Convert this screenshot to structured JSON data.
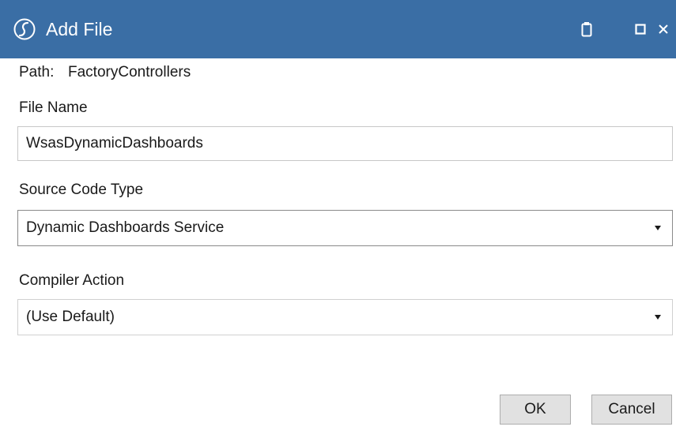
{
  "dialog": {
    "title": "Add File",
    "title_icon": "script-s-icon",
    "titlebar_buttons": [
      "clipboard-icon",
      "maximize-icon",
      "close-icon"
    ],
    "colors": {
      "titlebar": "#3a6ea5",
      "title_text": "#ffffff"
    }
  },
  "path": {
    "label": "Path:",
    "value": "FactoryControllers"
  },
  "file_name": {
    "label": "File Name",
    "value": "WsasDynamicDashboards"
  },
  "source_code_type": {
    "label": "Source Code Type",
    "selected": "Dynamic Dashboards Service"
  },
  "compiler_action": {
    "label": "Compiler Action",
    "selected": "(Use Default)"
  },
  "buttons": {
    "ok": "OK",
    "cancel": "Cancel"
  }
}
